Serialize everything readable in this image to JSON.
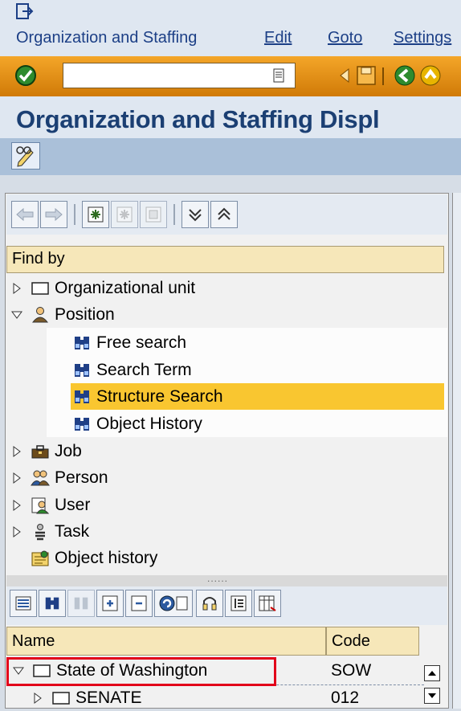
{
  "menubar": {
    "items": [
      {
        "label": "Organization and Staffing"
      },
      {
        "label": "Edit"
      },
      {
        "label": "Goto"
      },
      {
        "label": "Settings"
      }
    ]
  },
  "toolbar": {
    "command_field_value": ""
  },
  "page_title": "Organization and Staffing Displ",
  "find_by": {
    "header": "Find by",
    "items": [
      {
        "label": "Organizational unit",
        "expanded": false
      },
      {
        "label": "Position",
        "expanded": true,
        "children": [
          {
            "label": "Free search"
          },
          {
            "label": "Search Term"
          },
          {
            "label": "Structure Search",
            "selected": true
          },
          {
            "label": "Object History"
          }
        ]
      },
      {
        "label": "Job",
        "expanded": false
      },
      {
        "label": "Person",
        "expanded": false
      },
      {
        "label": "User",
        "expanded": false
      },
      {
        "label": "Task",
        "expanded": false
      },
      {
        "label": "Object history"
      }
    ]
  },
  "splitter_dots": "......",
  "grid": {
    "columns": [
      "Name",
      "Code"
    ],
    "rows": [
      {
        "name": "State of Washington",
        "code": "SOW",
        "expanded": true
      },
      {
        "name": "SENATE",
        "code": "012",
        "expanded": false
      }
    ]
  },
  "colors": {
    "highlight": "#f9c630",
    "header_bg": "#f6e7b9",
    "title_text": "#1b3f73",
    "selection_outline": "#e2001a"
  }
}
